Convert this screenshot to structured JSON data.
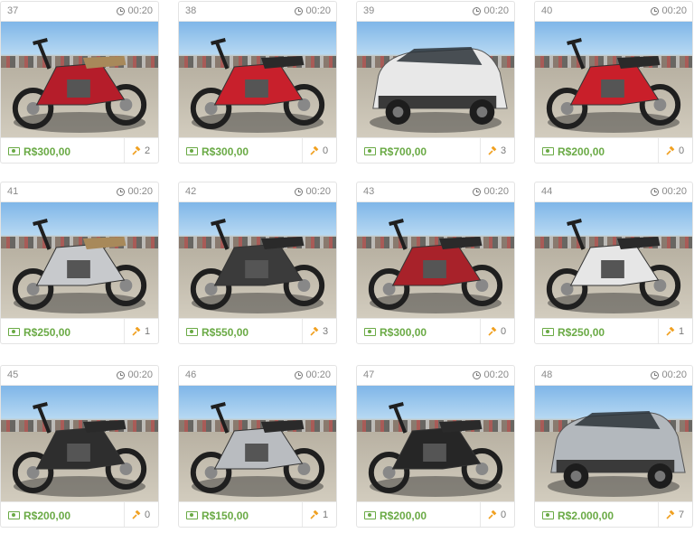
{
  "colors": {
    "price": "#6aaa45",
    "gavel": "#f0a020"
  },
  "lots": [
    {
      "number": "37",
      "time": "00:20",
      "price": "R$300,00",
      "bids": "2",
      "vehicle": "red-scooter",
      "tone": "#b51d2a"
    },
    {
      "number": "38",
      "time": "00:20",
      "price": "R$300,00",
      "bids": "0",
      "vehicle": "red-motorcycle",
      "tone": "#c8202c"
    },
    {
      "number": "39",
      "time": "00:20",
      "price": "R$700,00",
      "bids": "3",
      "vehicle": "white-hatchback",
      "tone": "#e8e8e8"
    },
    {
      "number": "40",
      "time": "00:20",
      "price": "R$200,00",
      "bids": "0",
      "vehicle": "red-motorcycle",
      "tone": "#c91f2a"
    },
    {
      "number": "41",
      "time": "00:20",
      "price": "R$250,00",
      "bids": "1",
      "vehicle": "silver-scooter",
      "tone": "#c7c9cc"
    },
    {
      "number": "42",
      "time": "00:20",
      "price": "R$550,00",
      "bids": "3",
      "vehicle": "black-motorcycle",
      "tone": "#3b3b3b"
    },
    {
      "number": "43",
      "time": "00:20",
      "price": "R$300,00",
      "bids": "0",
      "vehicle": "red-motorcycle",
      "tone": "#a8222a"
    },
    {
      "number": "44",
      "time": "00:20",
      "price": "R$250,00",
      "bids": "1",
      "vehicle": "white-motorcycle",
      "tone": "#e6e6e6"
    },
    {
      "number": "45",
      "time": "00:20",
      "price": "R$200,00",
      "bids": "0",
      "vehicle": "black-motorcycle",
      "tone": "#2e2e2e"
    },
    {
      "number": "46",
      "time": "00:20",
      "price": "R$150,00",
      "bids": "1",
      "vehicle": "silver-motorcycle",
      "tone": "#b9bcc0"
    },
    {
      "number": "47",
      "time": "00:20",
      "price": "R$200,00",
      "bids": "0",
      "vehicle": "black-motorcycle",
      "tone": "#262626"
    },
    {
      "number": "48",
      "time": "00:20",
      "price": "R$2.000,00",
      "bids": "7",
      "vehicle": "silver-hatchback",
      "tone": "#b3b8bd"
    }
  ]
}
